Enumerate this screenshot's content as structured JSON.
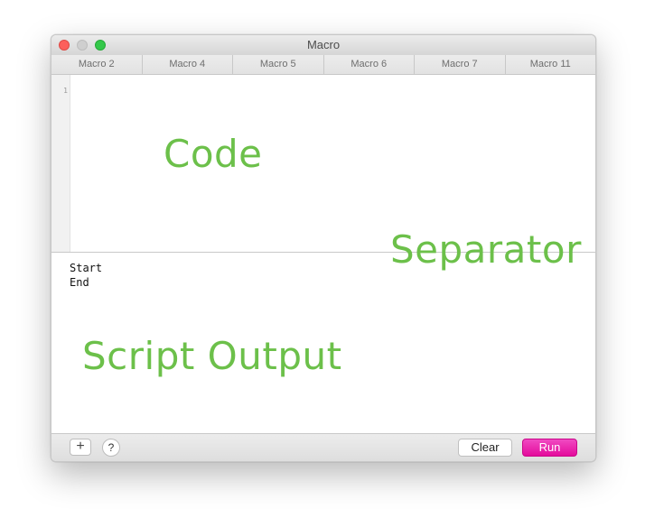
{
  "window": {
    "title": "Macro"
  },
  "tabs": [
    {
      "label": "Macro 2"
    },
    {
      "label": "Macro 4"
    },
    {
      "label": "Macro 5"
    },
    {
      "label": "Macro 6"
    },
    {
      "label": "Macro 7"
    },
    {
      "label": "Macro 11"
    }
  ],
  "editor": {
    "line_numbers": [
      "1"
    ],
    "code": ""
  },
  "output": {
    "lines": [
      "Start",
      "End"
    ]
  },
  "toolbar": {
    "add_label": "+",
    "help_label": "?",
    "clear_label": "Clear",
    "run_label": "Run"
  },
  "annotations": {
    "code": "Code",
    "separator": "Separator",
    "output": "Script Output"
  },
  "colors": {
    "run_button": "#e40b9c",
    "annotation": "#6cc04a",
    "traffic_close": "#fc605c",
    "traffic_zoom": "#34c84a"
  }
}
